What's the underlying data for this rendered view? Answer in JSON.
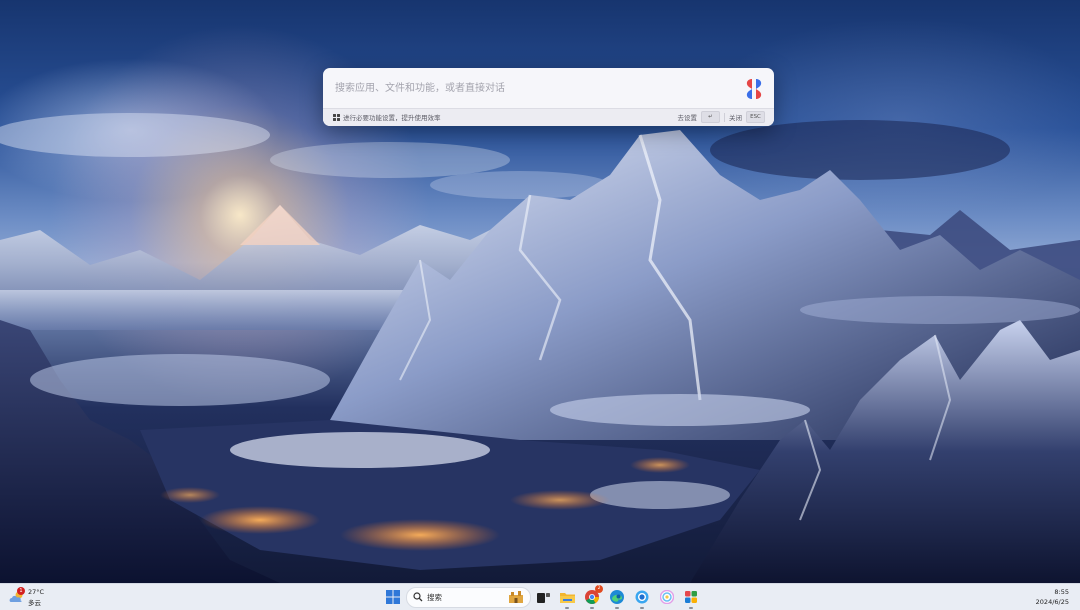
{
  "launcher": {
    "placeholder": "搜索应用、文件和功能，或者直接对话",
    "footer_tip": "进行必要功能设置，提升使用效率",
    "settings_label": "去设置",
    "enter_key": "↵",
    "close_label": "关闭",
    "esc_key": "ESC"
  },
  "taskbar": {
    "weather": {
      "temperature": "27°C",
      "condition": "多云",
      "badge": "1"
    },
    "search_label": "搜索",
    "apps": [
      {
        "name": "task-view",
        "running": false
      },
      {
        "name": "file-explorer",
        "running": true
      },
      {
        "name": "chrome",
        "running": true,
        "badge": "2"
      },
      {
        "name": "edge",
        "running": true
      },
      {
        "name": "browser-blue",
        "running": true
      },
      {
        "name": "copilot",
        "running": false
      },
      {
        "name": "photos",
        "running": true
      }
    ],
    "clock": {
      "time": "8:55",
      "date": "2024/6/25"
    }
  },
  "colors": {
    "accent": "#2f6fd6",
    "logo_red": "#e54646",
    "logo_blue": "#3a6ee8",
    "badge_red": "#d32020"
  }
}
